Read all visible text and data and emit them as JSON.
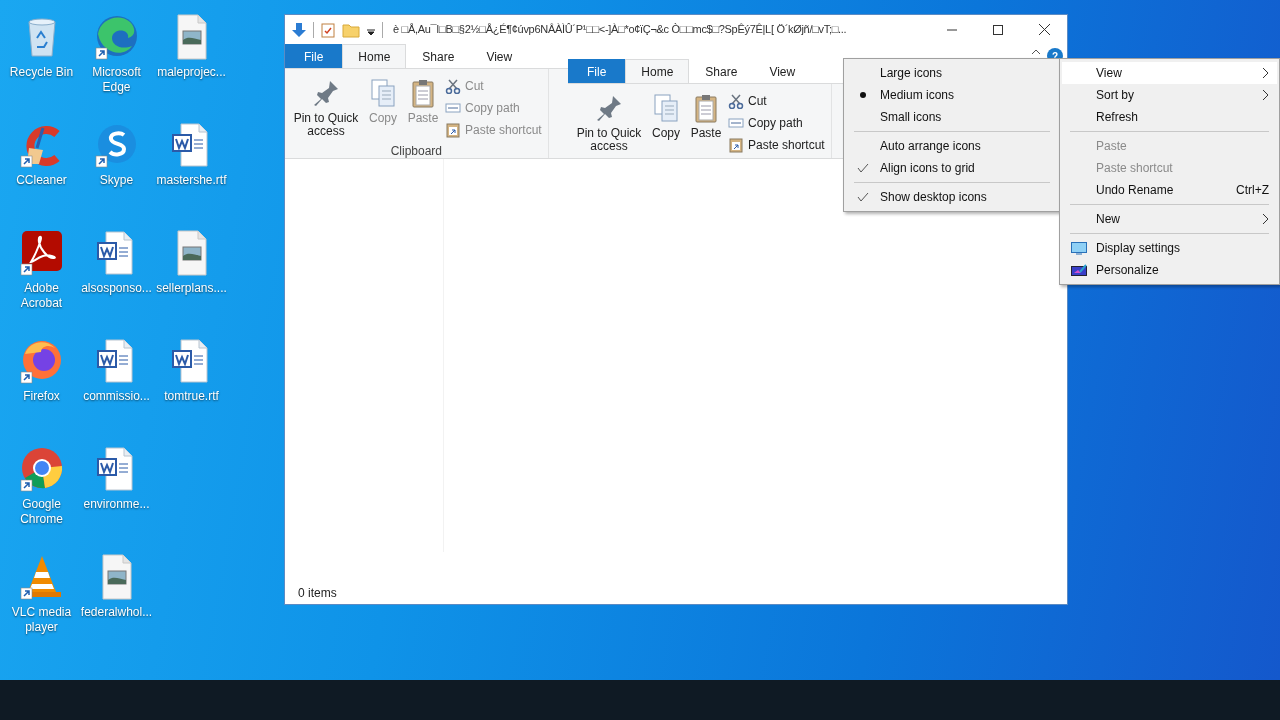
{
  "desktop_icons": [
    {
      "label": "Recycle Bin",
      "kind": "recycle",
      "shortcut": false
    },
    {
      "label": "CCleaner",
      "kind": "ccleaner",
      "shortcut": true
    },
    {
      "label": "Adobe Acrobat",
      "kind": "acrobat",
      "shortcut": true
    },
    {
      "label": "Firefox",
      "kind": "firefox",
      "shortcut": true
    },
    {
      "label": "Google Chrome",
      "kind": "chrome",
      "shortcut": true
    },
    {
      "label": "VLC media player",
      "kind": "vlc",
      "shortcut": true
    },
    {
      "label": "Microsoft Edge",
      "kind": "edge",
      "shortcut": true
    },
    {
      "label": "Skype",
      "kind": "skype",
      "shortcut": true
    },
    {
      "label": "alsosponso...",
      "kind": "word",
      "shortcut": false
    },
    {
      "label": "commissio...",
      "kind": "word",
      "shortcut": false
    },
    {
      "label": "environme...",
      "kind": "word",
      "shortcut": false
    },
    {
      "label": "federalwhol...",
      "kind": "image",
      "shortcut": false
    },
    {
      "label": "maleprojec...",
      "kind": "image",
      "shortcut": false
    },
    {
      "label": "mastershe.rtf",
      "kind": "word",
      "shortcut": false
    },
    {
      "label": "sellerplans....",
      "kind": "image",
      "shortcut": false
    },
    {
      "label": "tomtrue.rtf",
      "kind": "word",
      "shortcut": false
    }
  ],
  "explorer": {
    "title": "è  □Å,Au¯I□B□§2½□Å¿É¶¢úvp6NÂÀÌÛ´P¹□□<-]À□*o¢ïÇ¬&c Ò□□mc$□?SpÊý7Ê|L[  Ö´kØjñ/□vT;□...",
    "help": "?",
    "ribbon": {
      "tabs": [
        {
          "label": "File",
          "kind": "file",
          "selected": false
        },
        {
          "label": "Home",
          "kind": "tab",
          "selected": true
        },
        {
          "label": "Share",
          "kind": "tab",
          "selected": false
        },
        {
          "label": "View",
          "kind": "tab",
          "selected": false
        }
      ],
      "large_buttons": [
        {
          "label": "Pin to Quick access",
          "disabled": false
        },
        {
          "label": "Copy",
          "disabled": true
        },
        {
          "label": "Paste",
          "disabled": true
        }
      ],
      "small_buttons": [
        {
          "label": "Cut",
          "disabled": true
        },
        {
          "label": "Copy path",
          "disabled": true
        },
        {
          "label": "Paste shortcut",
          "disabled": true
        }
      ],
      "group_label": "Clipboard"
    },
    "overlay_ribbon": {
      "tabs": [
        {
          "label": "File",
          "kind": "file",
          "selected": false
        },
        {
          "label": "Home",
          "kind": "tab",
          "selected": true
        },
        {
          "label": "Share",
          "kind": "tab",
          "selected": false
        },
        {
          "label": "View",
          "kind": "tab",
          "selected": false
        }
      ],
      "large_buttons": [
        {
          "label": "Pin to Quick access",
          "disabled": false
        },
        {
          "label": "Copy",
          "disabled": false
        },
        {
          "label": "Paste",
          "disabled": false
        }
      ],
      "small_buttons": [
        {
          "label": "Cut",
          "disabled": false
        },
        {
          "label": "Copy path",
          "disabled": false
        },
        {
          "label": "Paste shortcut",
          "disabled": false
        }
      ]
    },
    "status_bar": "0 items"
  },
  "view_menu": {
    "items": [
      {
        "kind": "radio",
        "label": "Large icons",
        "selected": false
      },
      {
        "kind": "radio",
        "label": "Medium icons",
        "selected": true
      },
      {
        "kind": "radio",
        "label": "Small icons",
        "selected": false
      },
      {
        "kind": "separator"
      },
      {
        "kind": "check",
        "label": "Auto arrange icons",
        "checked": false
      },
      {
        "kind": "check",
        "label": "Align icons to grid",
        "checked": true
      },
      {
        "kind": "separator"
      },
      {
        "kind": "check",
        "label": "Show desktop icons",
        "checked": true
      }
    ]
  },
  "context_menu": {
    "items": [
      {
        "kind": "item",
        "label": "View",
        "submenu": true,
        "highlighted": true,
        "disabled": false
      },
      {
        "kind": "item",
        "label": "Sort by",
        "submenu": true,
        "highlighted": false,
        "disabled": false
      },
      {
        "kind": "item",
        "label": "Refresh",
        "submenu": false,
        "highlighted": false,
        "disabled": false
      },
      {
        "kind": "separator"
      },
      {
        "kind": "item",
        "label": "Paste",
        "submenu": false,
        "highlighted": false,
        "disabled": true
      },
      {
        "kind": "item",
        "label": "Paste shortcut",
        "submenu": false,
        "highlighted": false,
        "disabled": true
      },
      {
        "kind": "item",
        "label": "Undo Rename",
        "shortcut": "Ctrl+Z",
        "submenu": false,
        "highlighted": false,
        "disabled": false
      },
      {
        "kind": "separator"
      },
      {
        "kind": "item",
        "label": "New",
        "submenu": true,
        "highlighted": false,
        "disabled": false
      },
      {
        "kind": "separator"
      },
      {
        "kind": "icon_item",
        "label": "Display settings",
        "submenu": false,
        "highlighted": false,
        "disabled": false
      },
      {
        "kind": "icon_item",
        "label": "Personalize",
        "submenu": false,
        "highlighted": false,
        "disabled": false
      }
    ]
  }
}
